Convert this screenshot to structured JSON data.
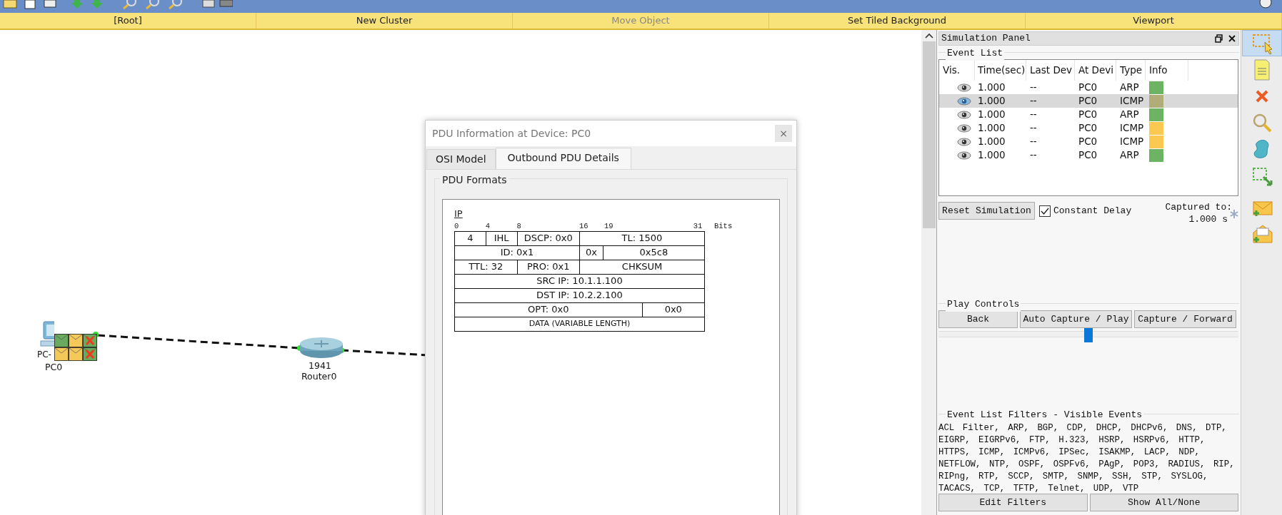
{
  "toolbar": {
    "items": [
      {
        "label": "[Root]",
        "disabled": false
      },
      {
        "label": "New Cluster",
        "disabled": false
      },
      {
        "label": "Move Object",
        "disabled": true
      },
      {
        "label": "Set Tiled Background",
        "disabled": false
      },
      {
        "label": "Viewport",
        "disabled": false
      }
    ]
  },
  "canvas": {
    "devices": [
      {
        "kind": "pc",
        "label": "PC-",
        "name": "PC0",
        "pdus": [
          {
            "color": "#6aaa5e",
            "failed": false
          },
          {
            "color": "#f5c85a",
            "failed": false
          },
          {
            "color": "#6aaa5e",
            "failed": true
          },
          {
            "color": "#f5c85a",
            "failed": false
          },
          {
            "color": "#f5c85a",
            "failed": false
          },
          {
            "color": "#6aaa5e",
            "failed": true
          }
        ]
      },
      {
        "kind": "router",
        "model": "1941",
        "name": "Router0"
      }
    ]
  },
  "pdu_dialog": {
    "title": "PDU Information at Device: PC0",
    "close": "×",
    "tabs": [
      {
        "label": "OSI Model",
        "selected": false
      },
      {
        "label": "Outbound PDU Details",
        "selected": true
      }
    ],
    "group": "PDU Formats",
    "header": "IP",
    "ruler": [
      "0",
      "4",
      "8",
      "16",
      "19",
      "31"
    ],
    "ruler_unit": "Bits",
    "field_rows": [
      {
        "fields": [
          "4",
          "IHL",
          "DSCP: 0x0",
          "TL: 1500"
        ]
      },
      {
        "fields": [
          "ID: 0x1",
          "0x",
          "0x5c8"
        ]
      },
      {
        "fields": [
          "TTL: 32",
          "PRO: 0x1",
          "CHKSUM"
        ]
      },
      {
        "fields": [
          "SRC IP: 10.1.1.100"
        ]
      },
      {
        "fields": [
          "DST IP: 10.2.2.100"
        ]
      },
      {
        "fields": [
          "OPT: 0x0",
          "0x0"
        ]
      },
      {
        "fields": [
          "DATA (VARIABLE LENGTH)"
        ],
        "kind": "small"
      }
    ]
  },
  "simulation_panel": {
    "title": "Simulation Panel",
    "event_list": {
      "legend": "Event List",
      "columns": [
        "Vis.",
        "Time(sec)",
        "Last Dev",
        "At Devi",
        "Type",
        "Info"
      ],
      "rows": [
        {
          "time": "1.000",
          "last": "--",
          "at": "PC0",
          "type": "ARP",
          "color": "#6cb463",
          "selected": false
        },
        {
          "time": "1.000",
          "last": "--",
          "at": "PC0",
          "type": "ICMP",
          "color": "#b0ad78",
          "selected": true
        },
        {
          "time": "1.000",
          "last": "--",
          "at": "PC0",
          "type": "ARP",
          "color": "#6cb463",
          "selected": false
        },
        {
          "time": "1.000",
          "last": "--",
          "at": "PC0",
          "type": "ICMP",
          "color": "#fbc94f",
          "selected": false
        },
        {
          "time": "1.000",
          "last": "--",
          "at": "PC0",
          "type": "ICMP",
          "color": "#fbc94f",
          "selected": false
        },
        {
          "time": "1.000",
          "last": "--",
          "at": "PC0",
          "type": "ARP",
          "color": "#6cb463",
          "selected": false
        }
      ]
    },
    "reset_button": "Reset Simulation",
    "constant_delay": {
      "label": "Constant Delay",
      "checked": true
    },
    "captured_label": "Captured to:",
    "captured_value": "1.000 s",
    "play_controls": {
      "legend": "Play Controls",
      "buttons": [
        "Back",
        "Auto Capture / Play",
        "Capture / Forward"
      ],
      "speed": {
        "level": 0.5
      }
    },
    "filters": {
      "legend": "Event List Filters - Visible Events",
      "text": "ACL Filter, ARP, BGP, CDP, DHCP, DHCPv6, DNS, DTP, EIGRP, EIGRPv6, FTP, H.323, HSRP, HSRPv6, HTTP, HTTPS, ICMP, ICMPv6, IPSec, ISAKMP, LACP, NDP, NETFLOW, NTP, OSPF, OSPFv6, PAgP, POP3, RADIUS, RIP, RIPng, RTP, SCCP, SMTP, SNMP, SSH, STP, SYSLOG, TACACS, TCP, TFTP, Telnet, UDP, VTP",
      "buttons": [
        "Edit Filters",
        "Show All/None"
      ]
    }
  },
  "side_tools": [
    {
      "kind": "select",
      "selected": true
    },
    {
      "kind": "note",
      "selected": false
    },
    {
      "kind": "delete",
      "selected": false
    },
    {
      "kind": "inspect",
      "selected": false
    },
    {
      "kind": "shape",
      "selected": false
    },
    {
      "kind": "resize",
      "selected": false
    },
    {
      "kind": "simple-pdu",
      "selected": false
    },
    {
      "kind": "complex-pdu",
      "selected": false
    }
  ]
}
